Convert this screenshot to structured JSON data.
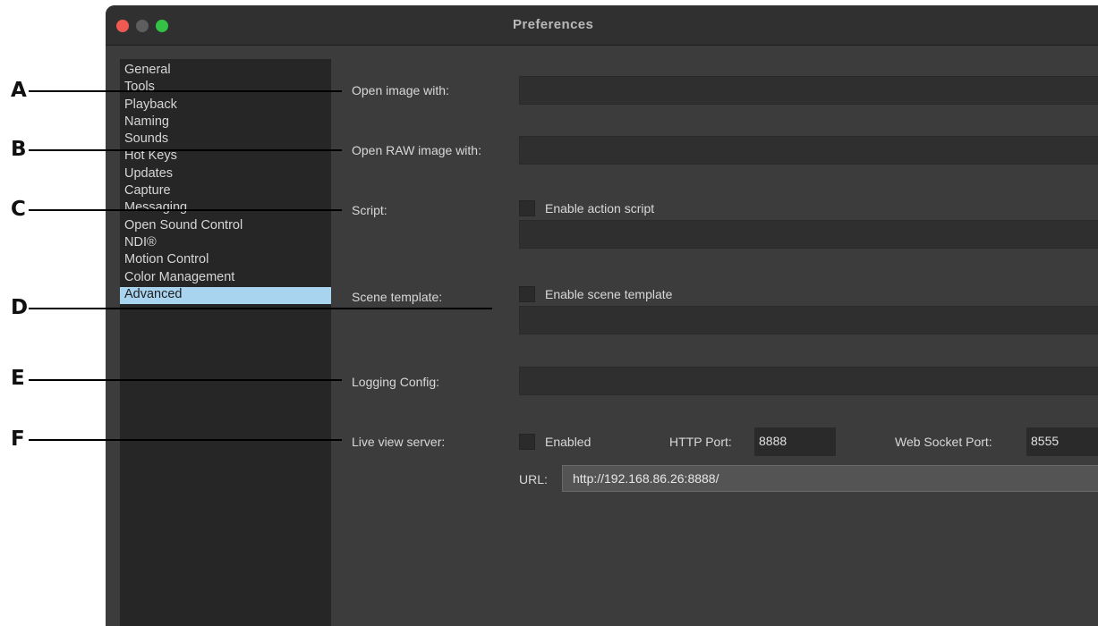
{
  "window": {
    "title": "Preferences"
  },
  "sidebar": {
    "items": [
      {
        "label": "General"
      },
      {
        "label": "Tools"
      },
      {
        "label": "Playback"
      },
      {
        "label": "Naming"
      },
      {
        "label": "Sounds"
      },
      {
        "label": "Hot Keys"
      },
      {
        "label": "Updates"
      },
      {
        "label": "Capture"
      },
      {
        "label": "Messaging"
      },
      {
        "label": "Open Sound Control"
      },
      {
        "label": "NDI®"
      },
      {
        "label": "Motion Control"
      },
      {
        "label": "Color Management"
      },
      {
        "label": "Advanced",
        "selected": true
      }
    ]
  },
  "form": {
    "open_image_label": "Open image with:",
    "open_image_value": "",
    "open_raw_label": "Open RAW image with:",
    "open_raw_value": "",
    "script_label": "Script:",
    "enable_action_script_label": "Enable action script",
    "action_script_value": "",
    "scene_template_label": "Scene template:",
    "enable_scene_template_label": "Enable scene template",
    "scene_template_value": "",
    "logging_config_label": "Logging Config:",
    "logging_config_value": "",
    "live_view_label": "Live view server:",
    "enabled_label": "Enabled",
    "http_port_label": "HTTP Port:",
    "http_port_value": "8888",
    "ws_port_label": "Web Socket Port:",
    "ws_port_value": "8555",
    "url_label": "URL:",
    "url_value": "http://192.168.86.26:8888/"
  },
  "callouts": [
    "A",
    "B",
    "C",
    "D",
    "E",
    "F"
  ]
}
